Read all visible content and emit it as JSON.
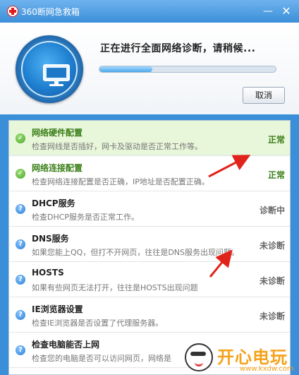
{
  "window": {
    "title": "360断网急救箱",
    "minimize_glyph": "—",
    "close_glyph": "✕"
  },
  "header": {
    "status_text": "正在进行全面网络诊断，请稍候...",
    "progress": 0.3,
    "cancel_label": "取消"
  },
  "items": [
    {
      "name": "网络硬件配置",
      "desc": "检查网线是否插好，网卡及驱动是否正常工作等。",
      "status": "正常",
      "state": "ok"
    },
    {
      "name": "网络连接配置",
      "desc": "检查网络连接配置是否正确，IP地址是否配置正确。",
      "status": "正常",
      "state": "ok"
    },
    {
      "name": "DHCP服务",
      "desc": "检查DHCP服务是否正常工作。",
      "status": "诊断中",
      "state": "checking"
    },
    {
      "name": "DNS服务",
      "desc": "如果您能上QQ，但打不开网页，往往是DNS服务出现问题。",
      "status": "未诊断",
      "state": "pending"
    },
    {
      "name": "HOSTS",
      "desc": "如果有些网页无法打开，往往是HOSTS出现问题",
      "status": "未诊断",
      "state": "pending"
    },
    {
      "name": "IE浏览器设置",
      "desc": "检查IE浏览器是否设置了代理服务器。",
      "status": "未诊断",
      "state": "pending"
    },
    {
      "name": "检查电脑能否上网",
      "desc": "检查您的电脑是否可以访问网页，网络是",
      "status": "",
      "state": "pending"
    }
  ],
  "watermark": {
    "title": "开心电玩",
    "url": "www.kxdw.com"
  },
  "colors": {
    "ok": "#3a7f18",
    "checking": "#666666",
    "pending": "#666666",
    "accent": "#3b8ed8"
  }
}
